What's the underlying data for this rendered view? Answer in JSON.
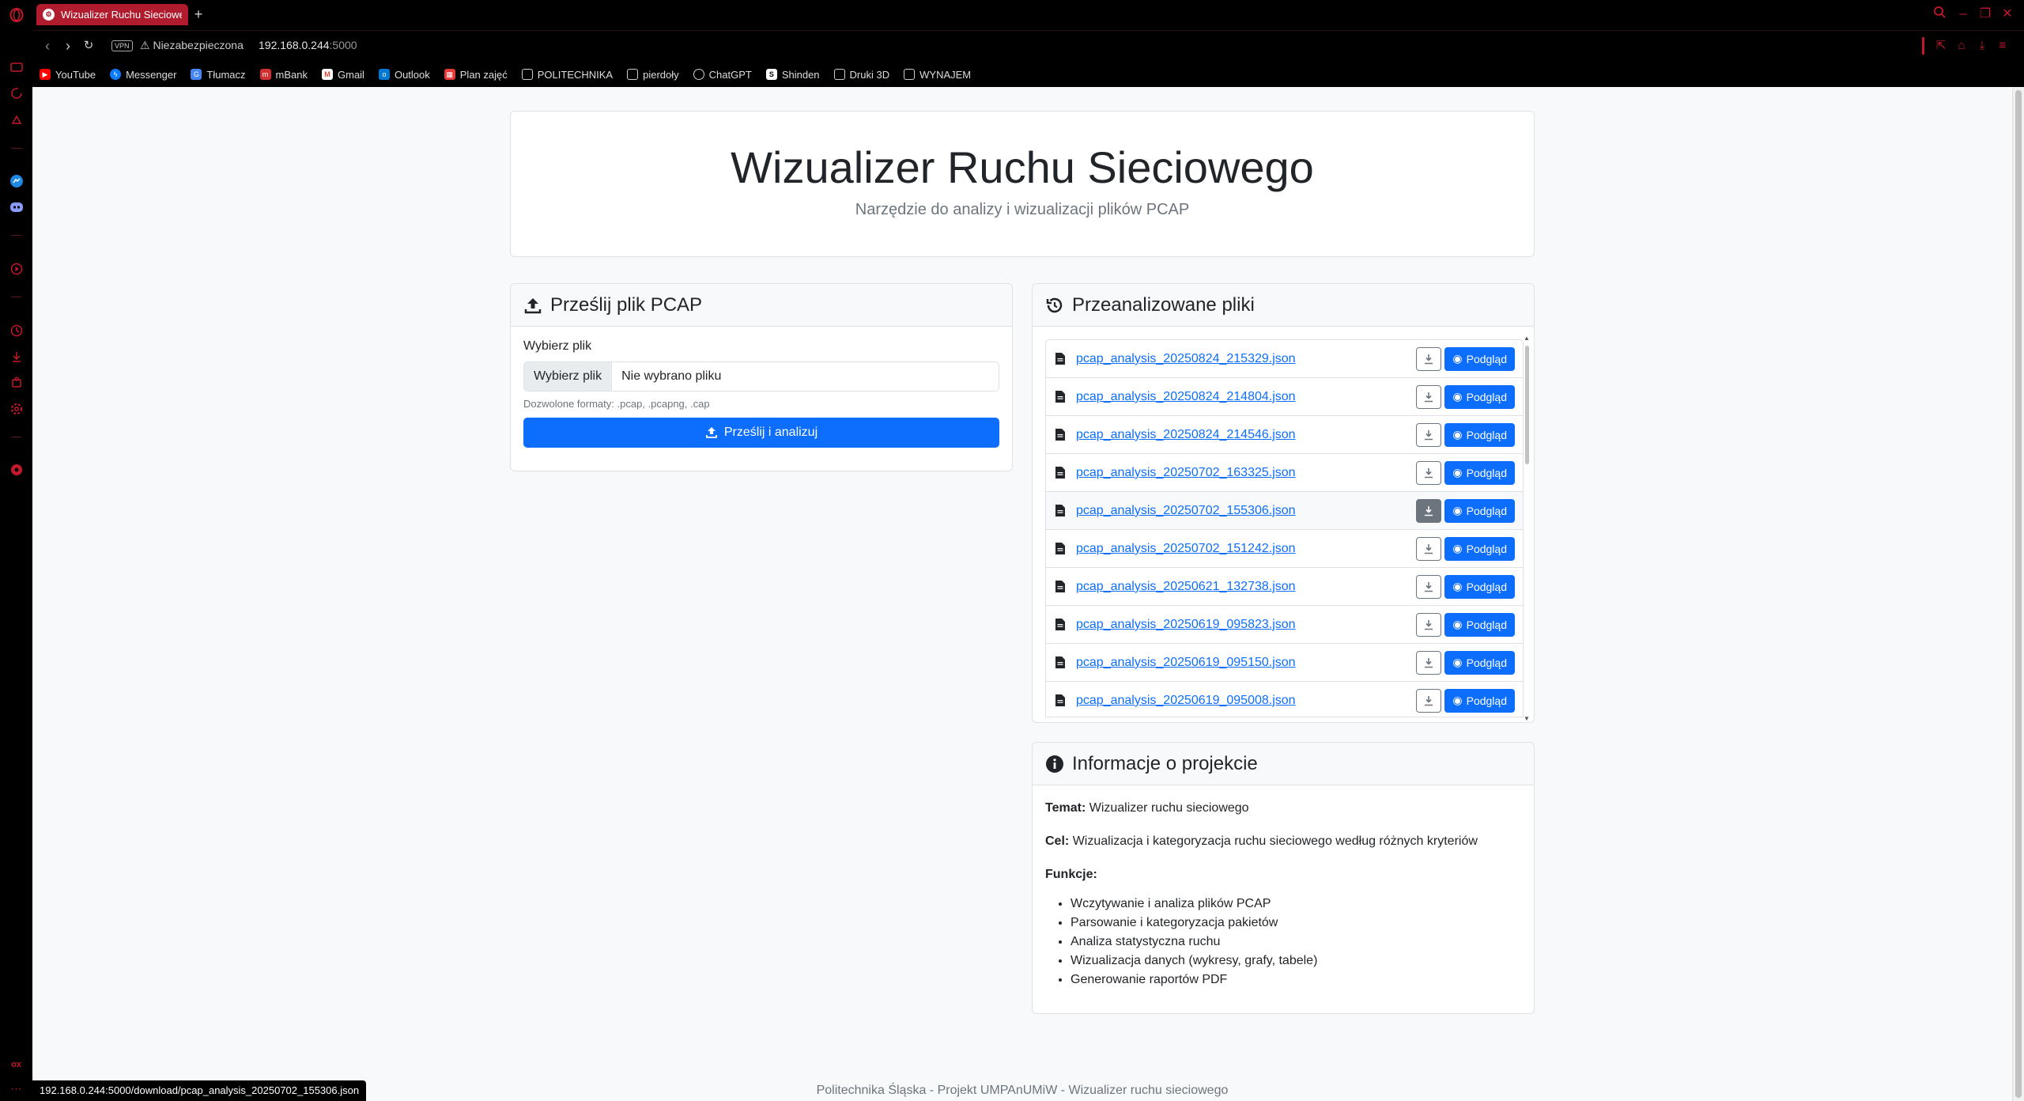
{
  "browser": {
    "tab_title": "Wizualizer Ruchu Sieciowego",
    "vpn_badge": "VPN",
    "security_label": "Niezabezpieczona",
    "url_host": "192.168.0.244",
    "url_port": ":5000",
    "status_url": "192.168.0.244:5000/download/pcap_analysis_20250702_155306.json",
    "accent_color": "#c4182b"
  },
  "bookmarks": [
    {
      "label": "YouTube",
      "icon": "youtube-icon",
      "color": "#ff0000"
    },
    {
      "label": "Messenger",
      "icon": "messenger-icon",
      "color": "#0a7cff"
    },
    {
      "label": "Tłumacz",
      "icon": "translate-icon",
      "color": "#4285f4"
    },
    {
      "label": "mBank",
      "icon": "mbank-icon",
      "color": "#d32f2f"
    },
    {
      "label": "Gmail",
      "icon": "gmail-icon",
      "color": "#ea4335"
    },
    {
      "label": "Outlook",
      "icon": "outlook-icon",
      "color": "#0078d4"
    },
    {
      "label": "Plan zajęć",
      "icon": "plan-icon",
      "color": "#e53935"
    },
    {
      "label": "POLITECHNIKA",
      "icon": "folder-icon",
      "color": "#000"
    },
    {
      "label": "pierdoły",
      "icon": "folder-icon",
      "color": "#000"
    },
    {
      "label": "ChatGPT",
      "icon": "chatgpt-icon",
      "color": "#000"
    },
    {
      "label": "Shinden",
      "icon": "shinden-icon",
      "color": "#000"
    },
    {
      "label": "Druki 3D",
      "icon": "folder-icon",
      "color": "#000"
    },
    {
      "label": "WYNAJEM",
      "icon": "folder-icon",
      "color": "#000"
    }
  ],
  "hero": {
    "title": "Wizualizer Ruchu Sieciowego",
    "subtitle": "Narzędzie do analizy i wizualizacji plików PCAP"
  },
  "upload": {
    "header": "Prześlij plik PCAP",
    "label": "Wybierz plik",
    "file_button": "Wybierz plik",
    "file_status": "Nie wybrano pliku",
    "help": "Dozwolone formaty: .pcap, .pcapng, .cap",
    "submit": "Prześlij i analizuj"
  },
  "files": {
    "header": "Przeanalizowane pliki",
    "preview_label": "Podgląd",
    "items": [
      "pcap_analysis_20250824_215329.json",
      "pcap_analysis_20250824_214804.json",
      "pcap_analysis_20250824_214546.json",
      "pcap_analysis_20250702_163325.json",
      "pcap_analysis_20250702_155306.json",
      "pcap_analysis_20250702_151242.json",
      "pcap_analysis_20250621_132738.json",
      "pcap_analysis_20250619_095823.json",
      "pcap_analysis_20250619_095150.json",
      "pcap_analysis_20250619_095008.json"
    ]
  },
  "info": {
    "header": "Informacje o projekcie",
    "topic_label": "Temat:",
    "topic": "Wizualizer ruchu sieciowego",
    "goal_label": "Cel:",
    "goal": "Wizualizacja i kategoryzacja ruchu sieciowego według różnych kryteriów",
    "features_label": "Funkcje:",
    "features": [
      "Wczytywanie i analiza plików PCAP",
      "Parsowanie i kategoryzacja pakietów",
      "Analiza statystyczna ruchu",
      "Wizualizacja danych (wykresy, grafy, tabele)",
      "Generowanie raportów PDF"
    ]
  },
  "footer": "Politechnika Śląska - Projekt UMPAnUMiW - Wizualizer ruchu sieciowego"
}
